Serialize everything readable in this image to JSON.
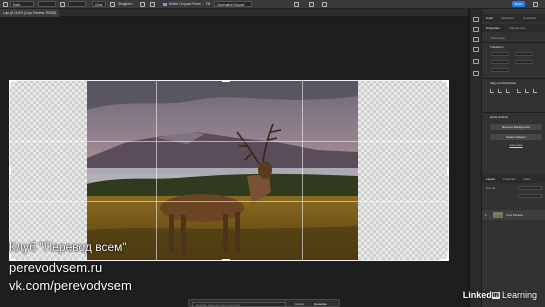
{
  "options_bar": {
    "ratio_label": "Ratio",
    "clear_label": "Clear",
    "straighten_label": "Straighten",
    "delete_pixels_label": "Delete Cropped Pixels",
    "fill_label": "Fill",
    "fill_value": "Generative Expand",
    "share_label": "Share"
  },
  "document_tab": {
    "title": "Lujo @ 15.6% (Crop Preview, RGB/8)"
  },
  "panel": {
    "top_tabs": [
      "Color",
      "Swatches",
      "Gradients"
    ],
    "prop_tabs": [
      "Properties",
      "Adjustments"
    ],
    "pixel_layer_label": "Pixel Layer",
    "transform_label": "Transform",
    "align_label": "Align and Distribute",
    "quick_actions_label": "Quick Actions",
    "remove_bg_label": "Remove Background",
    "select_subject_label": "Select Subject",
    "view_more_label": "View more",
    "layer_tabs": [
      "Layers",
      "Channels",
      "Paths"
    ],
    "blend_mode": "Normal",
    "layer_name": "Crop Preview"
  },
  "contextual_bar": {
    "prompt_placeholder": "Describe what you want to generate",
    "cancel_label": "Cancel",
    "generate_label": "Generate"
  },
  "watermark": {
    "line1": "Клуб \"Перевод всем\"",
    "line2": "perevodvsem.ru",
    "line3": "vk.com/perevodvsem"
  },
  "brand": {
    "linked": "Linked",
    "in": "in",
    "learning": "Learning"
  },
  "colors": {
    "accent": "#2680eb",
    "canvas_bg": "#1e1e1e",
    "panel_bg": "#323232"
  }
}
